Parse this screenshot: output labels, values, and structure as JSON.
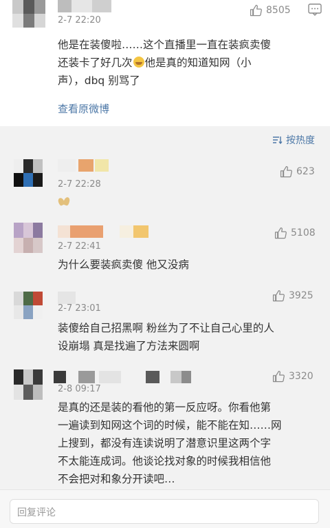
{
  "top_comment": {
    "time": "2-7 22:20",
    "likes": "8505",
    "text_lines": [
      "他是在装傻啦……这个直播里一直在装疯卖傻",
      "还装卡了好几次",
      "他是真的知道知网（小",
      "声），dbq 别骂了"
    ],
    "emoji": "laughing-crying-emoji",
    "view_original": "查看原微博"
  },
  "sort": {
    "label": "按热度"
  },
  "comments": [
    {
      "time": "2-7 22:28",
      "likes": "623",
      "text_lines": [],
      "emoji": "peanut-emoji"
    },
    {
      "time": "2-7 22:41",
      "likes": "5108",
      "text_lines": [
        "为什么要装疯卖傻 他又没病"
      ]
    },
    {
      "time": "2-7 23:01",
      "likes": "3925",
      "text_lines": [
        "装傻给自己招黑啊 粉丝为了不让自己心里的人",
        "设崩塌 真是找遍了方法来圆啊"
      ]
    },
    {
      "time": "2-8 09:17",
      "likes": "3320",
      "text_lines": [
        "是真的还是装的看他的第一反应呀。你看他第",
        "一遍读到知网这个词的时候，能不能在知……网",
        "上搜到，都没有连读说明了潜意识里这两个字",
        "不太能连成词。他谈论找对象的时候我相信他",
        "不会把对和象分开读吧…"
      ]
    }
  ],
  "reply": {
    "placeholder": "回复评论"
  },
  "colors": {
    "link": "#4d78a7",
    "meta": "#8a8a8a",
    "text": "#333333",
    "background": "#f2f2f2"
  },
  "icons": [
    "thumbs-up-icon",
    "more-icon",
    "sort-icon"
  ]
}
